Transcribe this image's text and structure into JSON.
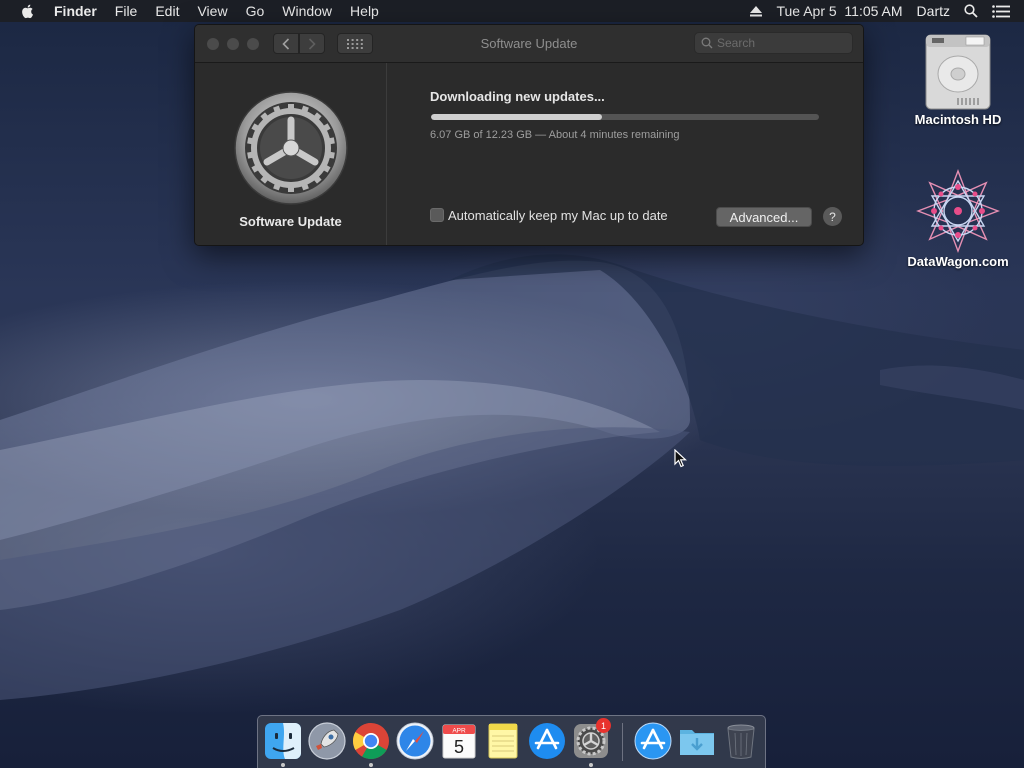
{
  "menubar": {
    "app_name": "Finder",
    "items": [
      "File",
      "Edit",
      "View",
      "Go",
      "Window",
      "Help"
    ],
    "datetime": "Tue Apr 5  11:05 AM",
    "user": "Dartz"
  },
  "window": {
    "title": "Software Update",
    "search_placeholder": "Search",
    "pane_label": "Software Update",
    "status": "Downloading new updates...",
    "progress_fraction": 0.44,
    "progress_text": "6.07 GB of 12.23 GB — About 4 minutes remaining",
    "auto_update_label": "Automatically keep my Mac up to date",
    "auto_update_checked": false,
    "advanced_label": "Advanced...",
    "help_label": "?"
  },
  "desktop_icons": [
    {
      "label": "Macintosh HD",
      "icon": "hard-drive-icon"
    },
    {
      "label": "DataWagon.com",
      "icon": "mandala-icon"
    }
  ],
  "dock": {
    "items": [
      "finder-icon",
      "launchpad-icon",
      "chrome-icon",
      "safari-icon",
      "calendar-icon",
      "notes-icon",
      "app-store-icon",
      "system-preferences-icon",
      "app-store-download-icon",
      "downloads-folder-icon",
      "trash-icon"
    ],
    "calendar_month": "APR",
    "calendar_day": "5",
    "system_preferences_badge": "1"
  },
  "colors": {
    "progress_fill": "#cfcfcf",
    "badge": "#e8322d",
    "window_bg": "#2b2b2b"
  }
}
